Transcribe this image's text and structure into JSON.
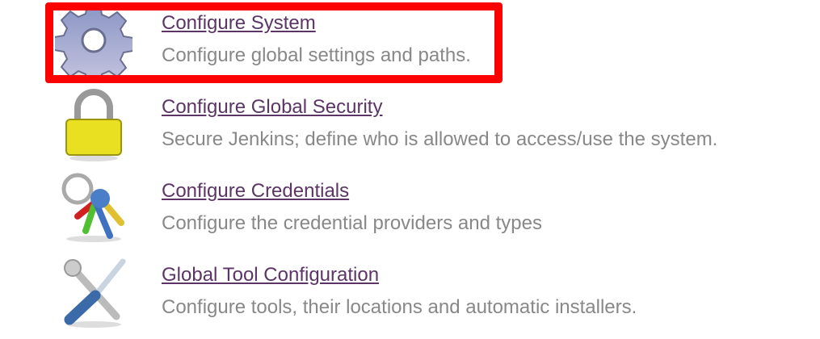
{
  "items": [
    {
      "title": "Configure System",
      "description": "Configure global settings and paths.",
      "icon": "gear-icon"
    },
    {
      "title": "Configure Global Security",
      "description": "Secure Jenkins; define who is allowed to access/use the system.",
      "icon": "lock-icon"
    },
    {
      "title": "Configure Credentials",
      "description": "Configure the credential providers and types",
      "icon": "keys-icon"
    },
    {
      "title": "Global Tool Configuration",
      "description": "Configure tools, their locations and automatic installers.",
      "icon": "tools-icon"
    }
  ],
  "highlight_color": "#ff0000"
}
